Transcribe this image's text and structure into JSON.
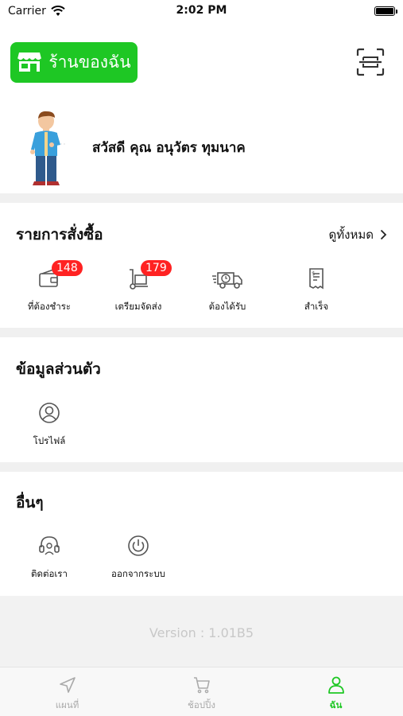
{
  "status_bar": {
    "carrier": "Carrier",
    "time": "2:02 PM"
  },
  "header": {
    "shop_button_label": "ร้านของฉัน"
  },
  "greeting": {
    "text": "สวัสดี คุณ อนุวัตร ทุมนาค"
  },
  "orders": {
    "title": "รายการสั่งซื้อ",
    "see_all": "ดูทั้งหมด",
    "items": [
      {
        "label": "ที่ต้องชำระ",
        "badge": "148",
        "icon": "wallet-icon"
      },
      {
        "label": "เตรียมจัดส่ง",
        "badge": "179",
        "icon": "box-cart-icon"
      },
      {
        "label": "ต้องได้รับ",
        "badge": "",
        "icon": "delivery-truck-icon"
      },
      {
        "label": "สำเร็จ",
        "badge": "",
        "icon": "receipt-icon"
      }
    ]
  },
  "personal": {
    "title": "ข้อมูลส่วนตัว",
    "items": [
      {
        "label": "โปรไฟล์",
        "icon": "profile-icon"
      }
    ]
  },
  "other": {
    "title": "อื่นๆ",
    "items": [
      {
        "label": "ติดต่อเรา",
        "icon": "headset-icon"
      },
      {
        "label": "ออกจากระบบ",
        "icon": "power-icon"
      }
    ]
  },
  "version": "Version : 1.01B5",
  "tabbar": {
    "tabs": [
      {
        "label": "แผนที่",
        "icon": "navigation-icon",
        "active": false
      },
      {
        "label": "ช้อปปิ้ง",
        "icon": "cart-icon",
        "active": false
      },
      {
        "label": "ฉัน",
        "icon": "user-icon",
        "active": true
      }
    ]
  },
  "colors": {
    "accent": "#1ec724",
    "badge": "#ff2222",
    "gap": "#f0f0f0"
  }
}
